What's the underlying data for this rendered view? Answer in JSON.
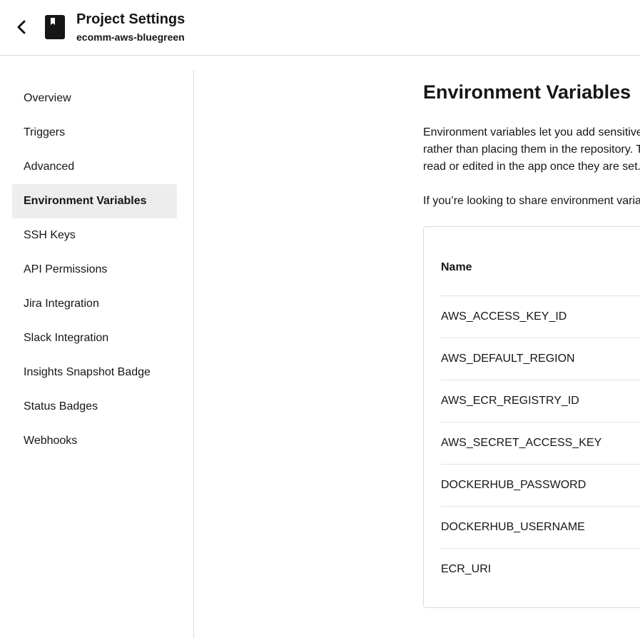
{
  "header": {
    "back_icon": "chevron-left-icon",
    "project_icon": "bookmark-book-icon",
    "title": "Project Settings",
    "project_name": "ecomm-aws-bluegreen"
  },
  "sidebar": {
    "active": "Environment Variables",
    "items": [
      {
        "label": "Overview"
      },
      {
        "label": "Triggers"
      },
      {
        "label": "Advanced"
      },
      {
        "label": "Environment Variables"
      },
      {
        "label": "SSH Keys"
      },
      {
        "label": "API Permissions"
      },
      {
        "label": "Jira Integration"
      },
      {
        "label": "Slack Integration"
      },
      {
        "label": "Insights Snapshot Badge"
      },
      {
        "label": "Status Badges"
      },
      {
        "label": "Webhooks"
      }
    ]
  },
  "main": {
    "title": "Environment Variables",
    "description": "Environment variables let you add sensitive data (e.g. API keys) to your jobs rather than placing them in the repository. The value of the variables cannot be read or edited in the app once they are set.",
    "description2": "If you’re looking to share environment variables across projects, try Contexts.",
    "table": {
      "column_name": "Name",
      "rows": [
        "AWS_ACCESS_KEY_ID",
        "AWS_DEFAULT_REGION",
        "AWS_ECR_REGISTRY_ID",
        "AWS_SECRET_ACCESS_KEY",
        "DOCKERHUB_PASSWORD",
        "DOCKERHUB_USERNAME",
        "ECR_URI"
      ]
    }
  }
}
